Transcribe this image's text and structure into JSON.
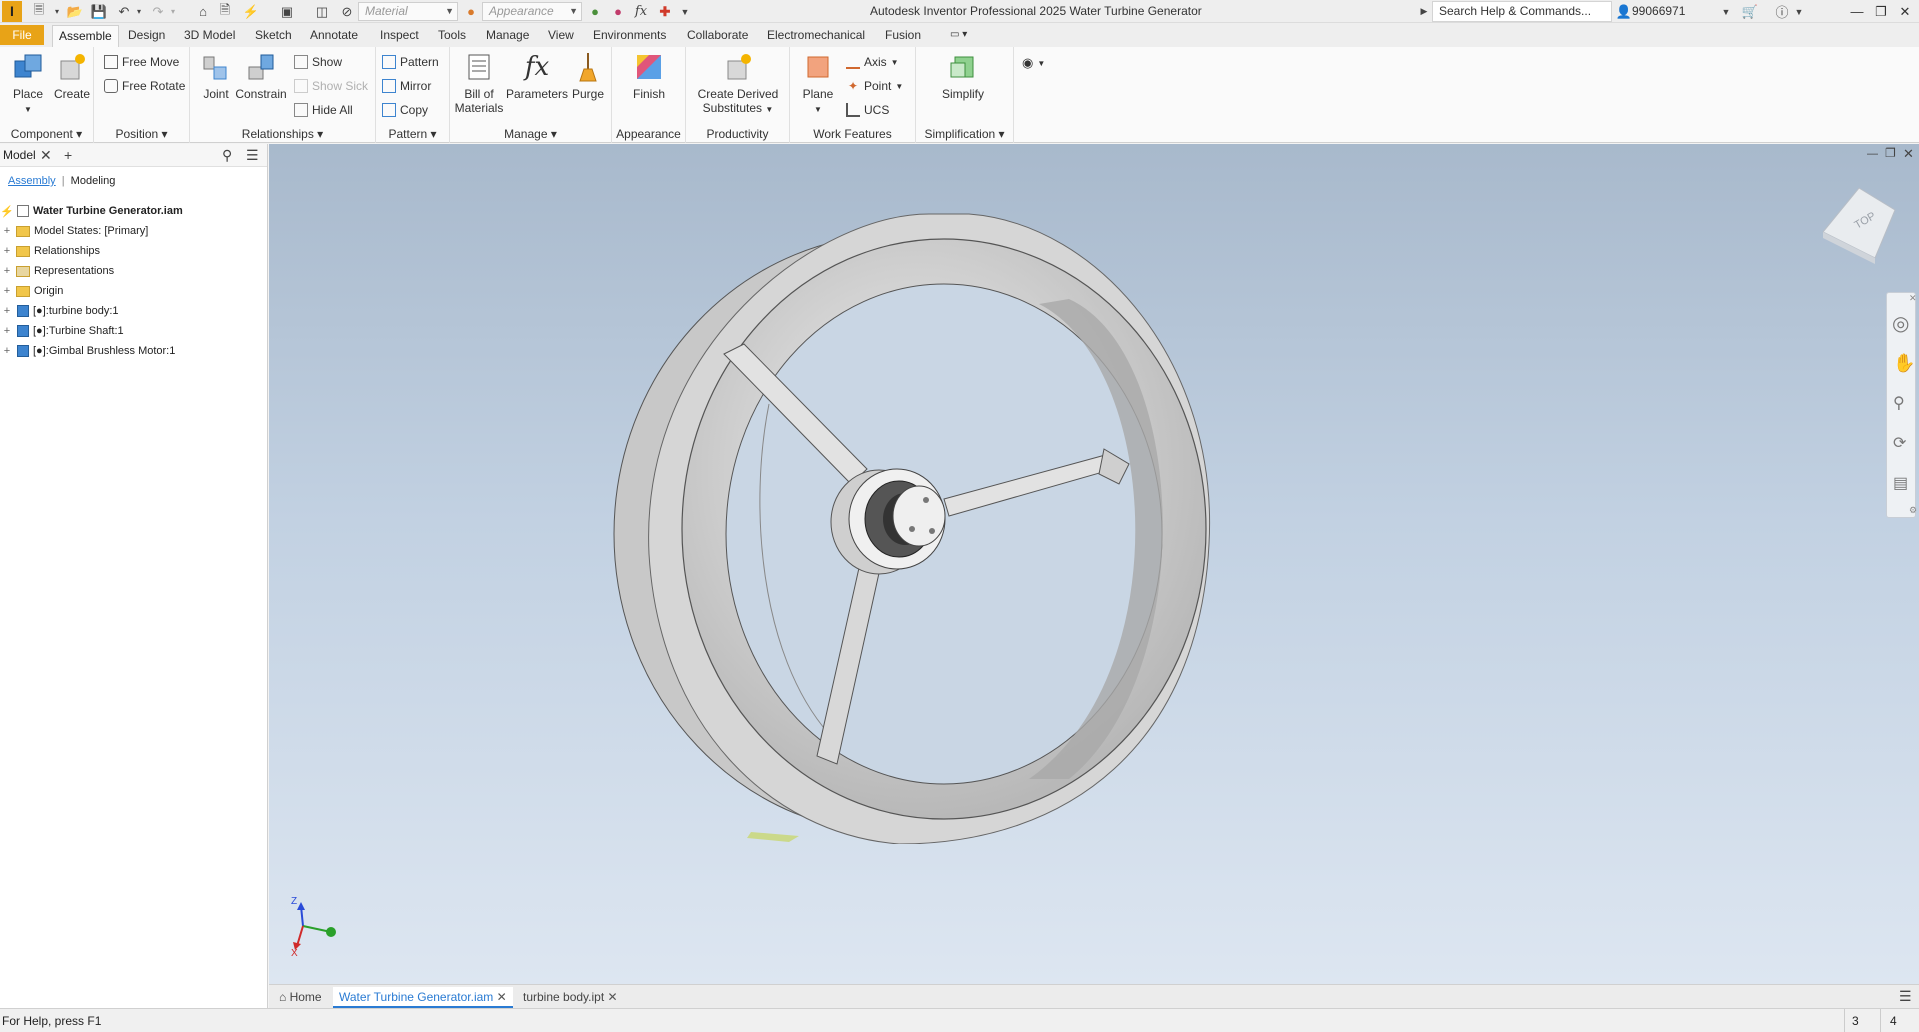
{
  "titlebar": {
    "app_logo": "I",
    "material_placeholder": "Material",
    "appearance_placeholder": "Appearance",
    "window_title": "Autodesk Inventor Professional 2025   Water Turbine Generator",
    "search_placeholder": "Search Help & Commands...",
    "user": "99066971"
  },
  "menu": {
    "file": "File",
    "tabs": [
      "Assemble",
      "Design",
      "3D Model",
      "Sketch",
      "Annotate",
      "Inspect",
      "Tools",
      "Manage",
      "View",
      "Environments",
      "Collaborate",
      "Electromechanical",
      "Fusion"
    ]
  },
  "ribbon": {
    "component": {
      "title": "Component",
      "place": "Place",
      "create": "Create"
    },
    "position": {
      "title": "Position",
      "free_move": "Free Move",
      "free_rotate": "Free Rotate"
    },
    "relationships": {
      "title": "Relationships",
      "joint": "Joint",
      "constrain": "Constrain",
      "show": "Show",
      "show_sick": "Show Sick",
      "hide_all": "Hide All"
    },
    "pattern": {
      "title": "Pattern",
      "pattern": "Pattern",
      "mirror": "Mirror",
      "copy": "Copy"
    },
    "manage": {
      "title": "Manage",
      "bom_line1": "Bill of",
      "bom_line2": "Materials",
      "parameters": "Parameters",
      "purge": "Purge"
    },
    "appearance": {
      "title": "Appearance",
      "finish": "Finish"
    },
    "productivity": {
      "title": "Productivity",
      "cds_line1": "Create Derived",
      "cds_line2": "Substitutes"
    },
    "work_features": {
      "title": "Work Features",
      "plane": "Plane",
      "axis": "Axis",
      "point": "Point",
      "ucs": "UCS"
    },
    "simplification": {
      "title": "Simplification",
      "simplify": "Simplify"
    }
  },
  "browser": {
    "tab": "Model",
    "sub_assembly": "Assembly",
    "sub_modeling": "Modeling",
    "tree": [
      {
        "label": "Water Turbine Generator.iam",
        "type": "root"
      },
      {
        "label": "Model States: [Primary]",
        "type": "folder"
      },
      {
        "label": "Relationships",
        "type": "folder"
      },
      {
        "label": "Representations",
        "type": "folder"
      },
      {
        "label": "Origin",
        "type": "folder"
      },
      {
        "label": "[●]:turbine body:1",
        "type": "part"
      },
      {
        "label": "[●]:Turbine Shaft:1",
        "type": "part"
      },
      {
        "label": "[●]:Gimbal Brushless Motor:1",
        "type": "part"
      }
    ]
  },
  "viewcube": {
    "face": "TOP"
  },
  "triad": {
    "z": "Z",
    "x": "X"
  },
  "doc_tabs": {
    "home": "Home",
    "active": "Water Turbine Generator.iam",
    "other": "turbine body.ipt"
  },
  "status": {
    "help": "For Help, press F1",
    "num1": "3",
    "num2": "4"
  }
}
